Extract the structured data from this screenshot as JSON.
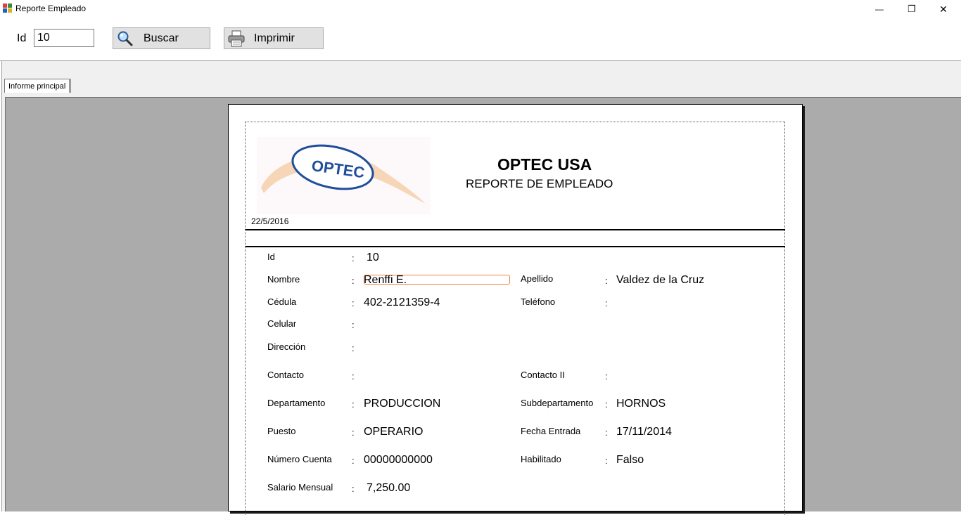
{
  "window": {
    "title": "Reporte Empleado",
    "minimize_glyph": "—",
    "restore_glyph": "❐",
    "close_glyph": "✕"
  },
  "toolbar": {
    "id_label": "Id",
    "id_value": "10",
    "search_label": "Buscar",
    "search_icon": "magnifier-icon",
    "print_label": "Imprimir",
    "print_icon": "printer-icon"
  },
  "viewer": {
    "tabs": [
      {
        "label": "Informe principal"
      }
    ]
  },
  "report": {
    "company": "OPTEC USA",
    "subtitle": "REPORTE DE EMPLEADO",
    "logo_text": "OPTEC",
    "date": "22/5/2016",
    "fields": {
      "id": {
        "label": "Id",
        "value": "10"
      },
      "nombre": {
        "label": "Nombre",
        "value": "Renffi E."
      },
      "apellido": {
        "label": "Apellido",
        "value": "Valdez de la Cruz"
      },
      "cedula": {
        "label": "Cédula",
        "value": "402-2121359-4"
      },
      "telefono": {
        "label": "Teléfono",
        "value": ""
      },
      "celular": {
        "label": "Celular",
        "value": ""
      },
      "direccion": {
        "label": "Dirección",
        "value": ""
      },
      "contacto": {
        "label": "Contacto",
        "value": ""
      },
      "contacto2": {
        "label": "Contacto II",
        "value": ""
      },
      "departamento": {
        "label": "Departamento",
        "value": "PRODUCCION"
      },
      "subdepartamento": {
        "label": "Subdepartamento",
        "value": "HORNOS"
      },
      "puesto": {
        "label": "Puesto",
        "value": "OPERARIO"
      },
      "fecha_entrada": {
        "label": "Fecha Entrada",
        "value": "17/11/2014"
      },
      "numero_cuenta": {
        "label": "Número Cuenta",
        "value": "00000000000"
      },
      "habilitado": {
        "label": "Habilitado",
        "value": "Falso"
      },
      "salario": {
        "label": "Salario Mensual",
        "value": "7,250.00"
      }
    },
    "separator": ":"
  },
  "colors": {
    "canvas": "#ababab",
    "logo_blue": "#1f4e9b",
    "logo_swoosh": "#f4c9a0",
    "selection": "#f08040"
  }
}
